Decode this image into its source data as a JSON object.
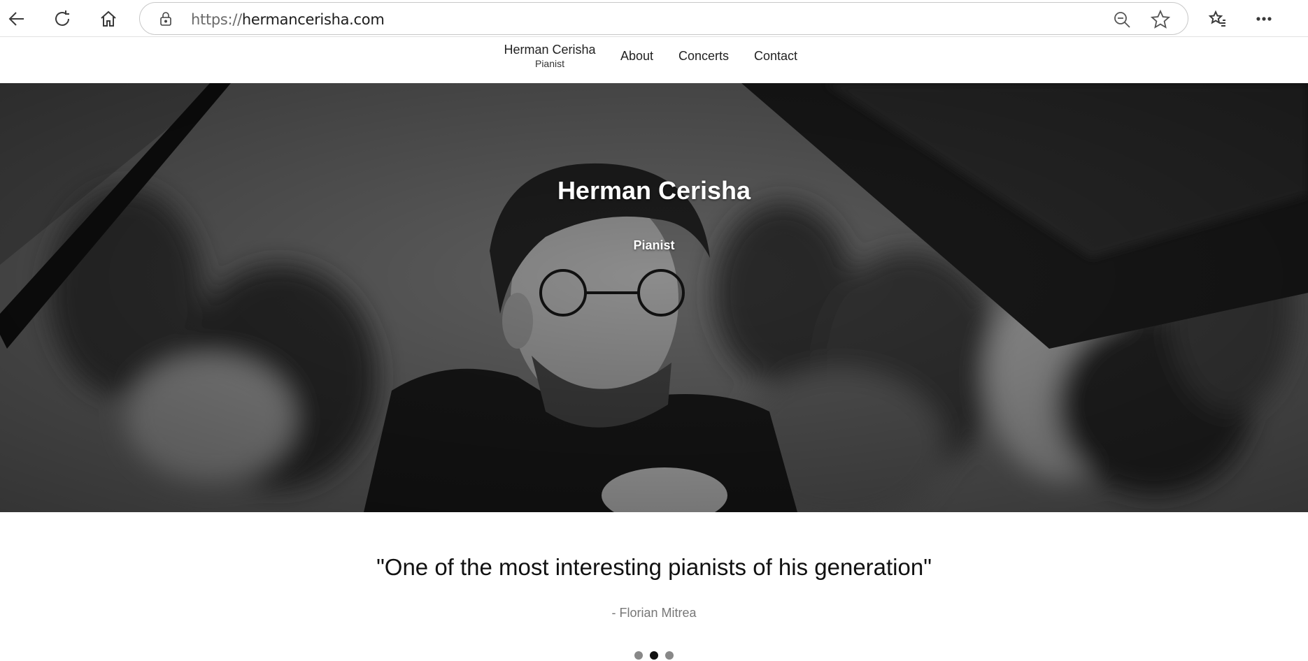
{
  "browser": {
    "url_scheme": "https://",
    "url_host": "hermancerisha.com"
  },
  "nav": {
    "brand_name": "Herman Cerisha",
    "brand_role": "Pianist",
    "links": [
      "About",
      "Concerts",
      "Contact"
    ]
  },
  "hero": {
    "title": "Herman Cerisha",
    "subtitle": "Pianist"
  },
  "testimonial": {
    "quote": "\"One of the most interesting pianists of his generation\"",
    "author": "- Florian Mitrea",
    "slide_count": 3,
    "active_slide": 2
  },
  "icons": [
    "back-icon",
    "refresh-icon",
    "home-icon",
    "lock-icon",
    "zoom-out-icon",
    "star-icon",
    "favorites-icon",
    "more-icon"
  ]
}
